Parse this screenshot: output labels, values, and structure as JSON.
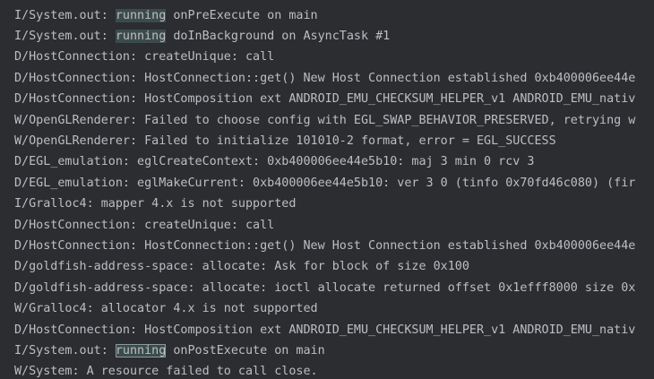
{
  "log": {
    "lines": [
      {
        "prefix": "I/System.out: ",
        "highlight": "running",
        "suffix": " onPreExecute on main",
        "hl_style": "fill"
      },
      {
        "prefix": "I/System.out: ",
        "highlight": "running",
        "suffix": " doInBackground on AsyncTask #1",
        "hl_style": "fill"
      },
      {
        "text": "D/HostConnection: createUnique: call"
      },
      {
        "text": "D/HostConnection: HostConnection::get() New Host Connection established 0xb400006ee44e"
      },
      {
        "text": "D/HostConnection: HostComposition ext ANDROID_EMU_CHECKSUM_HELPER_v1 ANDROID_EMU_nativ"
      },
      {
        "text": "W/OpenGLRenderer: Failed to choose config with EGL_SWAP_BEHAVIOR_PRESERVED, retrying w"
      },
      {
        "text": "W/OpenGLRenderer: Failed to initialize 101010-2 format, error = EGL_SUCCESS"
      },
      {
        "text": "D/EGL_emulation: eglCreateContext: 0xb400006ee44e5b10: maj 3 min 0 rcv 3"
      },
      {
        "text": "D/EGL_emulation: eglMakeCurrent: 0xb400006ee44e5b10: ver 3 0 (tinfo 0x70fd46c080) (fir"
      },
      {
        "text": "I/Gralloc4: mapper 4.x is not supported"
      },
      {
        "text": "D/HostConnection: createUnique: call"
      },
      {
        "text": "D/HostConnection: HostConnection::get() New Host Connection established 0xb400006ee44e"
      },
      {
        "text": "D/goldfish-address-space: allocate: Ask for block of size 0x100"
      },
      {
        "text": "D/goldfish-address-space: allocate: ioctl allocate returned offset 0x1efff8000 size 0x"
      },
      {
        "text": "W/Gralloc4: allocator 4.x is not supported"
      },
      {
        "text": "D/HostConnection: HostComposition ext ANDROID_EMU_CHECKSUM_HELPER_v1 ANDROID_EMU_nativ"
      },
      {
        "prefix": "I/System.out: ",
        "highlight": "running",
        "suffix": " onPostExecute on main",
        "hl_style": "box"
      },
      {
        "text": "W/System: A resource failed to call close."
      }
    ]
  },
  "colors": {
    "background": "#2b2d30",
    "text": "#bcbec4",
    "search_highlight": "#3b4b4b"
  }
}
